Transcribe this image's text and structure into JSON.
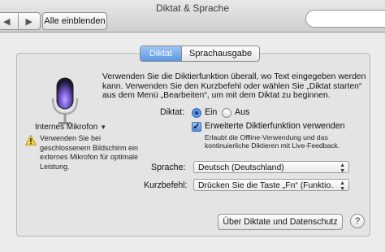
{
  "window": {
    "title": "Diktat & Sprache"
  },
  "toolbar": {
    "back_icon": "chevron-left-icon",
    "forward_icon": "chevron-right-icon",
    "show_all_label": "Alle einblenden",
    "search_placeholder": ""
  },
  "tabs": [
    {
      "label": "Diktat",
      "active": true
    },
    {
      "label": "Sprachausgabe",
      "active": false
    }
  ],
  "microphone": {
    "icon": "microphone-icon",
    "source_label": "Internes Mikrofon",
    "warning_icon": "warning-icon",
    "warning_text": "Verwenden Sie bei geschlossenem Bildschirm ein externes Mikrofon für optimale Leistung."
  },
  "dictation": {
    "intro_text": "Verwenden Sie die Diktierfunktion überall, wo Text eingegeben werden kann. Verwenden Sie den Kurzbefehl oder wählen Sie „Diktat starten“ aus dem Menü „Bearbeiten“, um mit dem Diktat zu beginnen.",
    "diktat_label": "Diktat:",
    "radio_on_label": "Ein",
    "radio_off_label": "Aus",
    "selected": "Ein",
    "enhanced_label": "Erweiterte Diktierfunktion verwenden",
    "enhanced_checked": true,
    "enhanced_help": "Erlaubt die Offline-Verwendung und das kontinuierliche Diktieren mit Live-Feedback.",
    "language_label": "Sprache:",
    "language_value": "Deutsch (Deutschland)",
    "shortcut_label": "Kurzbefehl:",
    "shortcut_value": "Drücken Sie die Taste „Fn“ (Funktio…",
    "about_button_label": "Über Diktate und Datenschutz",
    "help_label": "?"
  },
  "colors": {
    "accent": "#4f8ce0",
    "mic_glow": "#7b5ad8"
  }
}
